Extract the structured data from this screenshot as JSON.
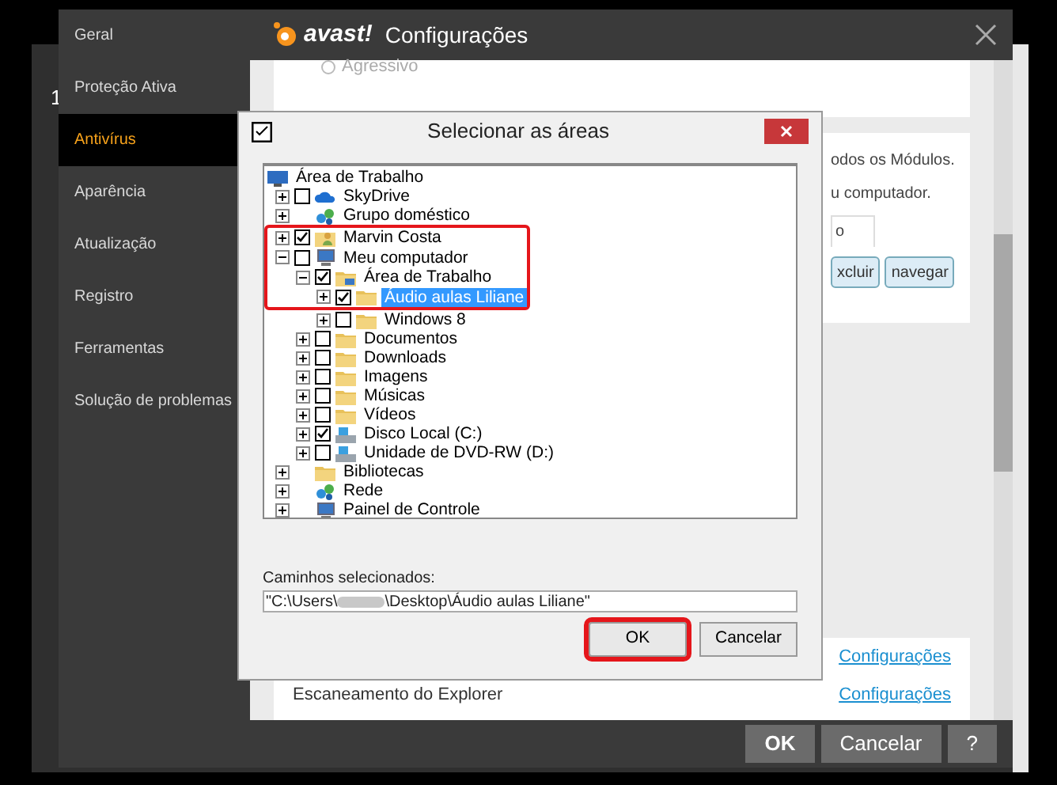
{
  "back_window": {
    "label": "1"
  },
  "window": {
    "logo": "avast!",
    "title": "Configurações"
  },
  "sidebar": {
    "items": [
      {
        "label": "Geral",
        "selected": false
      },
      {
        "label": "Proteção Ativa",
        "selected": false
      },
      {
        "label": "Antivírus",
        "selected": true
      },
      {
        "label": "Aparência",
        "selected": false
      },
      {
        "label": "Atualização",
        "selected": false
      },
      {
        "label": "Registro",
        "selected": false
      },
      {
        "label": "Ferramentas",
        "selected": false
      },
      {
        "label": "Solução de problemas",
        "selected": false
      }
    ]
  },
  "content": {
    "radio": {
      "label": "Agressivo",
      "selected": false
    },
    "description_lines": [
      "odos os Módulos.",
      "u computador."
    ],
    "tab": "o",
    "buttons": [
      "xcluir",
      "navegar"
    ],
    "rows": [
      {
        "link": "Configurações"
      },
      {
        "label": "Escaneamento do Explorer",
        "link": "Configurações"
      }
    ]
  },
  "footer_buttons": [
    "OK",
    "Cancelar",
    "?"
  ],
  "dialog": {
    "title": "Selecionar as áreas",
    "tree": [
      {
        "label": "Área de Trabalho",
        "kind": "desktop",
        "selected": false,
        "children": [
          {
            "label": "SkyDrive",
            "kind": "cloud",
            "expanded": false,
            "checked": false,
            "highlighted": false,
            "selected": false
          },
          {
            "label": "Grupo doméstico",
            "kind": "group",
            "expanded": false,
            "highlighted": false,
            "selected": false
          },
          {
            "label": "Marvin Costa",
            "kind": "user",
            "expanded": false,
            "checked": true,
            "highlighted": true,
            "selected": false
          },
          {
            "label": "Meu computador",
            "kind": "computer",
            "expanded": true,
            "checked": false,
            "highlighted": true,
            "selected": false,
            "children": [
              {
                "label": "Área de Trabalho",
                "kind": "desktop-folder",
                "expanded": true,
                "checked": true,
                "highlighted": true,
                "selected": false,
                "children": [
                  {
                    "label": "Áudio aulas Liliane",
                    "kind": "folder",
                    "expanded": false,
                    "checked": true,
                    "highlighted": true,
                    "selected": true
                  },
                  {
                    "label": "Windows 8",
                    "kind": "folder",
                    "expanded": false,
                    "checked": false,
                    "highlighted": false,
                    "selected": false
                  }
                ]
              },
              {
                "label": "Documentos",
                "kind": "folder",
                "expanded": false,
                "checked": false,
                "highlighted": false,
                "selected": false
              },
              {
                "label": "Downloads",
                "kind": "folder",
                "expanded": false,
                "checked": false,
                "highlighted": false,
                "selected": false
              },
              {
                "label": "Imagens",
                "kind": "folder",
                "expanded": false,
                "checked": false,
                "highlighted": false,
                "selected": false
              },
              {
                "label": "Músicas",
                "kind": "folder",
                "expanded": false,
                "checked": false,
                "highlighted": false,
                "selected": false
              },
              {
                "label": "Vídeos",
                "kind": "folder",
                "expanded": false,
                "checked": false,
                "highlighted": false,
                "selected": false
              },
              {
                "label": "Disco Local (C:)",
                "kind": "drive",
                "expanded": false,
                "checked": true,
                "highlighted": false,
                "selected": false
              },
              {
                "label": "Unidade de DVD-RW (D:)",
                "kind": "drive",
                "expanded": false,
                "checked": false,
                "highlighted": false,
                "selected": false
              }
            ]
          },
          {
            "label": "Bibliotecas",
            "kind": "folder",
            "expanded": false,
            "highlighted": false,
            "selected": false
          },
          {
            "label": "Rede",
            "kind": "group",
            "expanded": false,
            "highlighted": false,
            "selected": false
          },
          {
            "label": "Painel de Controle",
            "kind": "computer",
            "expanded": false,
            "highlighted": false,
            "selected": false
          }
        ]
      }
    ],
    "paths_label": "Caminhos selecionados:",
    "path_start": "\"C:\\Users\\",
    "path_end": "\\Desktop\\Áudio aulas Liliane\"",
    "buttons": [
      {
        "label": "OK",
        "highlighted": true
      },
      {
        "label": "Cancelar",
        "highlighted": false
      }
    ]
  }
}
